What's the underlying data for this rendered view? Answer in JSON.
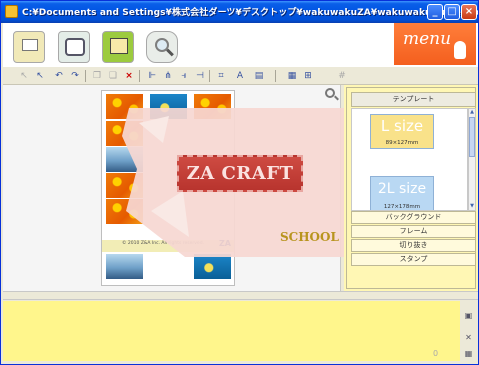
{
  "window": {
    "title": "C:¥Documents and Settings¥株式会社ダーツ¥デスクトップ¥wakuwakuZA¥wakuwaku_cube.zac",
    "minimize": "_",
    "maximize": "□",
    "close": "×"
  },
  "menu": {
    "label": "menu"
  },
  "template_panel": {
    "header": "テンプレート",
    "templates": [
      {
        "size": "L size",
        "dimensions": "89×127mm"
      },
      {
        "size": "2L size",
        "dimensions": "127×178mm"
      }
    ],
    "categories": [
      "バックグラウンド",
      "フレーム",
      "切り抜き",
      "スタンプ"
    ]
  },
  "canvas": {
    "watermark_title": "ZA CRAFT",
    "watermark_subtitle": "SCHOOL",
    "copyright": "© 2010 Z&A Inc. All rights reserved.",
    "logo": "ZA"
  },
  "toolbar": {
    "icons": [
      "select-arrow-icon",
      "select-plus-icon",
      "undo-icon",
      "redo-icon",
      "copy-icon",
      "paste-icon",
      "delete-icon",
      "align-left-icon",
      "align-center-icon",
      "align-right-icon",
      "align-top-icon",
      "crop-icon",
      "text-icon",
      "layer-icon",
      "grid-icon",
      "guide-icon",
      "snap-grid-icon"
    ]
  },
  "status": {
    "count": "0"
  },
  "colors": {
    "titlebar": "#0054E3",
    "menu": "#F45F1E",
    "panel": "#FFF7B4",
    "bottom": "#FFF68C",
    "watermark": "#F6D7D2",
    "banner": "#B8342E"
  }
}
